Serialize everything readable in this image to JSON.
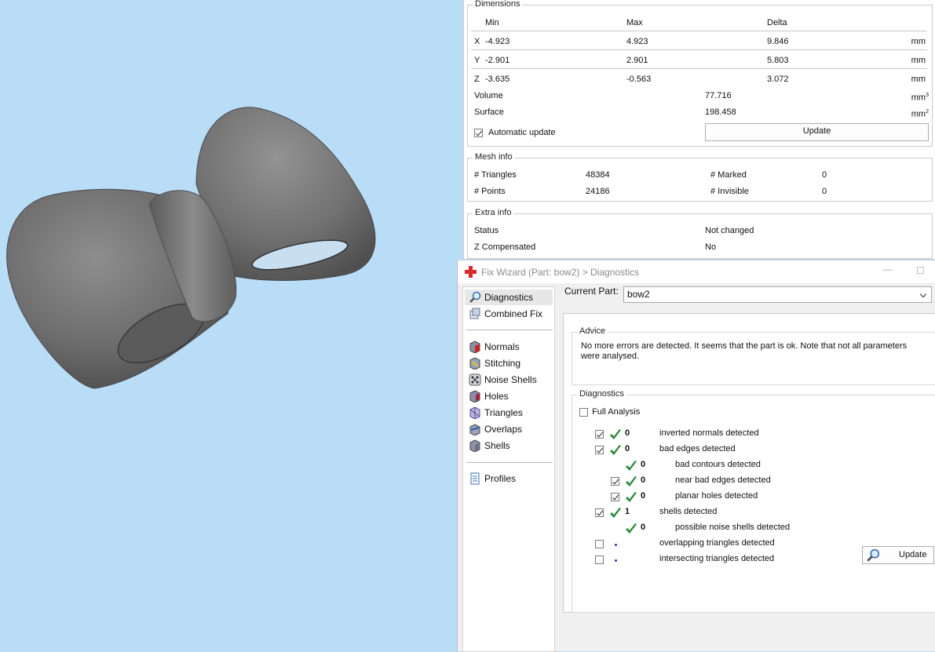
{
  "colors": {
    "viewport_bg": "#b9dcf7",
    "model": "#6f6f6f",
    "check_green": "#2e8b3a"
  },
  "dimensions": {
    "title": "Dimensions",
    "headers": {
      "min": "Min",
      "max": "Max",
      "delta": "Delta"
    },
    "rows": [
      {
        "axis": "X",
        "min": "-4.923",
        "max": "4.923",
        "delta": "9.846",
        "unit": "mm"
      },
      {
        "axis": "Y",
        "min": "-2.901",
        "max": "2.901",
        "delta": "5.803",
        "unit": "mm"
      },
      {
        "axis": "Z",
        "min": "-3.635",
        "max": "-0.563",
        "delta": "3.072",
        "unit": "mm"
      }
    ],
    "volume": {
      "label": "Volume",
      "value": "77.716",
      "unit": "mm",
      "exp": "3"
    },
    "surface": {
      "label": "Surface",
      "value": "198.458",
      "unit": "mm",
      "exp": "2"
    },
    "auto_update": {
      "label": "Automatic update",
      "checked": true
    },
    "update_button": "Update"
  },
  "mesh_info": {
    "title": "Mesh info",
    "triangles_label": "# Triangles",
    "triangles": "48384",
    "marked_label": "# Marked",
    "marked": "0",
    "points_label": "# Points",
    "points": "24186",
    "invisible_label": "# Invisible",
    "invisible": "0"
  },
  "extra_info": {
    "title": "Extra info",
    "status_label": "Status",
    "status": "Not changed",
    "zcomp_label": "Z Compensated",
    "zcomp": "No"
  },
  "wizard": {
    "title": "Fix Wizard (Part: bow2) > Diagnostics",
    "nav": [
      {
        "label": "Diagnostics",
        "icon": "magnifier-icon"
      },
      {
        "label": "Combined Fix",
        "icon": "combined-fix-icon"
      },
      {
        "label": "Normals",
        "icon": "normals-icon"
      },
      {
        "label": "Stitching",
        "icon": "stitching-icon"
      },
      {
        "label": "Noise Shells",
        "icon": "noise-shells-icon"
      },
      {
        "label": "Holes",
        "icon": "holes-icon"
      },
      {
        "label": "Triangles",
        "icon": "triangles-icon"
      },
      {
        "label": "Overlaps",
        "icon": "overlaps-icon"
      },
      {
        "label": "Shells",
        "icon": "shells-icon"
      },
      {
        "label": "Profiles",
        "icon": "profiles-icon"
      }
    ],
    "current_part_label": "Current Part:",
    "current_part": "bow2",
    "advice_title": "Advice",
    "advice_text_1": "No more errors are detected. It seems that the part is ok. Note that not all parameters",
    "advice_text_2": "were analysed.",
    "diagnostics_title": "Diagnostics",
    "full_analysis": {
      "label": "Full Analysis",
      "checked": false
    },
    "diagnostics": [
      {
        "checked": true,
        "status": "ok",
        "count": "0",
        "label": "inverted normals detected"
      },
      {
        "checked": true,
        "status": "ok",
        "count": "0",
        "label": "bad edges detected"
      },
      {
        "checked": null,
        "status": "ok",
        "count": "0",
        "label": "bad contours detected"
      },
      {
        "checked": true,
        "status": "ok",
        "count": "0",
        "label": "near bad edges detected"
      },
      {
        "checked": true,
        "status": "ok",
        "count": "0",
        "label": "planar holes detected"
      },
      {
        "checked": true,
        "status": "ok",
        "count": "1",
        "label": "shells detected"
      },
      {
        "checked": null,
        "status": "ok",
        "count": "0",
        "label": "possible noise shells detected"
      },
      {
        "checked": false,
        "status": "pending",
        "count": "",
        "label": "overlapping triangles detected"
      },
      {
        "checked": false,
        "status": "pending",
        "count": "",
        "label": "intersecting triangles detected"
      }
    ],
    "update_button": "Update"
  }
}
